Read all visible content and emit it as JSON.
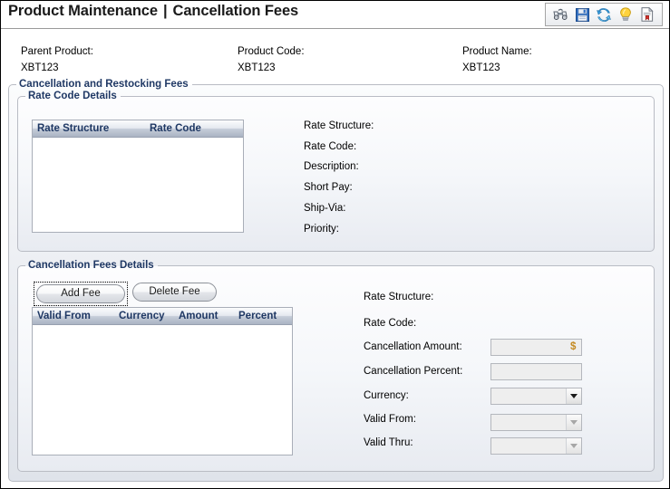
{
  "window": {
    "title_main": "Product Maintenance",
    "title_sep": "|",
    "title_sub": "Cancellation Fees"
  },
  "toolbar": {
    "items": [
      {
        "name": "binoculars-icon",
        "label": "View"
      },
      {
        "name": "save-icon",
        "label": "Save"
      },
      {
        "name": "refresh-icon",
        "label": "Refresh"
      },
      {
        "name": "lightbulb-icon",
        "label": "Hint"
      },
      {
        "name": "report-icon",
        "label": "Report"
      }
    ]
  },
  "header": {
    "parent_product_label": "Parent Product:",
    "parent_product_value": "XBT123",
    "product_code_label": "Product Code:",
    "product_code_value": "XBT123",
    "product_name_label": "Product Name:",
    "product_name_value": "XBT123"
  },
  "outer_group": {
    "legend": "Cancellation and Restocking Fees"
  },
  "rate_code_details": {
    "legend": "Rate Code Details",
    "grid": {
      "columns": [
        "Rate Structure",
        "Rate Code"
      ],
      "rows": []
    },
    "labels": [
      "Rate Structure:",
      "Rate Code:",
      "Description:",
      "Short Pay:",
      "Ship-Via:",
      "Priority:"
    ]
  },
  "cancellation_fees_details": {
    "legend": "Cancellation Fees Details",
    "add_button": "Add Fee",
    "delete_button": "Delete Fee",
    "grid": {
      "columns": [
        "Valid From",
        "Currency",
        "Amount",
        "Percent"
      ],
      "rows": []
    },
    "form": {
      "rate_structure_label": "Rate Structure:",
      "rate_structure_value": "",
      "rate_code_label": "Rate Code:",
      "rate_code_value": "",
      "cancellation_amount_label": "Cancellation Amount:",
      "cancellation_amount_value": "",
      "cancellation_amount_currency_symbol": "$",
      "cancellation_percent_label": "Cancellation Percent:",
      "cancellation_percent_value": "",
      "currency_label": "Currency:",
      "currency_value": "",
      "valid_from_label": "Valid From:",
      "valid_from_value": "",
      "valid_thru_label": "Valid Thru:",
      "valid_thru_value": ""
    }
  },
  "colors": {
    "legend_blue": "#1f3864",
    "grid_header_blue": "#1f3864",
    "panel_bg": "#e8ebf1",
    "money_symbol": "#c48a22"
  }
}
